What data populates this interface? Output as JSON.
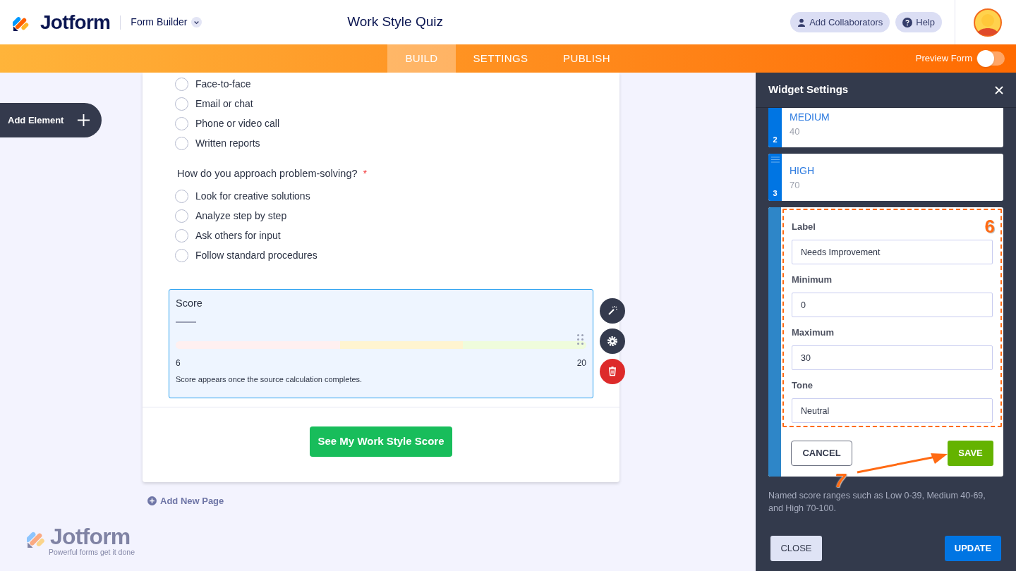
{
  "header": {
    "logo_text": "Jotform",
    "product_menu": "Form Builder",
    "form_title": "Work Style Quiz",
    "buttons": [
      {
        "label": "Add Collaborators",
        "kind": "person"
      },
      {
        "label": "Help",
        "kind": "help"
      }
    ]
  },
  "nav": {
    "tabs": [
      {
        "label": "BUILD",
        "selected": true
      },
      {
        "label": "SETTINGS",
        "selected": false
      },
      {
        "label": "PUBLISH",
        "selected": false
      }
    ],
    "preview": {
      "label": "Preview Form",
      "on": false
    }
  },
  "add_element": "Add Element",
  "form": {
    "questions": [
      {
        "options": [
          {
            "label": "Face-to-face",
            "checked": false
          },
          {
            "label": "Email or chat",
            "checked": false
          },
          {
            "label": "Phone or video call",
            "checked": false
          },
          {
            "label": "Written reports",
            "checked": false
          }
        ]
      },
      {
        "label": "How do you approach problem-solving?",
        "required": true,
        "required_mark": "*",
        "options": [
          {
            "label": "Look for creative solutions",
            "checked": false
          },
          {
            "label": "Analyze step by step",
            "checked": false
          },
          {
            "label": "Ask others for input",
            "checked": false
          },
          {
            "label": "Follow standard procedures",
            "checked": false
          }
        ]
      }
    ],
    "score_widget": {
      "title": "Score",
      "selected": true,
      "min": "6",
      "max": "20",
      "note": "Score appears once the source calculation completes.",
      "segments": [
        {
          "color": "#fff0f0"
        },
        {
          "color": "#fff4d0"
        },
        {
          "color": "#effcdc"
        }
      ]
    },
    "submit": "See My Work Style Score"
  },
  "add_page": "Add New Page",
  "footer_logo": {
    "name": "Jotform",
    "tagline": "Powerful forms get it done"
  },
  "panel": {
    "title": "Widget Settings",
    "ranges": [
      {
        "number": "2",
        "label": "MEDIUM",
        "value": "40"
      },
      {
        "number": "3",
        "label": "HIGH",
        "value": "70"
      }
    ],
    "editor": {
      "fields": [
        {
          "label": "Label",
          "value": "Needs Improvement"
        },
        {
          "label": "Minimum",
          "value": "0"
        },
        {
          "label": "Maximum",
          "value": "30"
        },
        {
          "label": "Tone",
          "value": "Neutral"
        }
      ],
      "cancel": "CANCEL",
      "save": "SAVE"
    },
    "help": "Named score ranges such as Low 0-39, Medium 40-69, and High 70-100.",
    "close": "CLOSE",
    "update": "UPDATE"
  },
  "annotations": [
    {
      "text": "6"
    },
    {
      "text": "7"
    }
  ]
}
